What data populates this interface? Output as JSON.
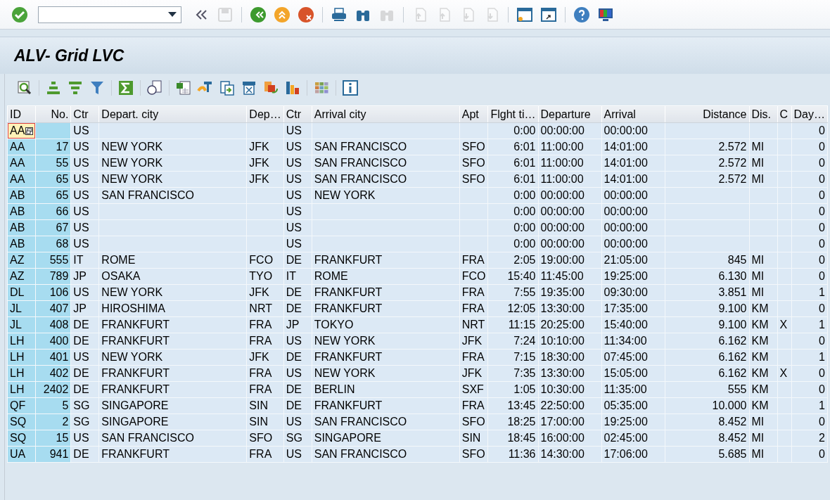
{
  "toolbar": [
    {
      "kind": "ok",
      "disabled": false
    },
    {
      "kind": "command-field",
      "disabled": false
    },
    {
      "kind": "collapse",
      "disabled": false
    },
    {
      "kind": "save",
      "disabled": true
    },
    {
      "kind": "sep"
    },
    {
      "kind": "back",
      "disabled": false
    },
    {
      "kind": "exit",
      "disabled": false
    },
    {
      "kind": "cancel",
      "disabled": false
    },
    {
      "kind": "sep"
    },
    {
      "kind": "print",
      "disabled": false
    },
    {
      "kind": "find",
      "disabled": false
    },
    {
      "kind": "find",
      "disabled": true
    },
    {
      "kind": "sep"
    },
    {
      "kind": "page-first",
      "disabled": true
    },
    {
      "kind": "page-prev",
      "disabled": true
    },
    {
      "kind": "page-next",
      "disabled": true
    },
    {
      "kind": "page-last",
      "disabled": true
    },
    {
      "kind": "sep"
    },
    {
      "kind": "new-session",
      "disabled": false
    },
    {
      "kind": "shortcut",
      "disabled": false
    },
    {
      "kind": "sep"
    },
    {
      "kind": "help",
      "disabled": false
    },
    {
      "kind": "layout",
      "disabled": false
    }
  ],
  "title": "ALV- Grid LVC",
  "grid_toolbar": [
    {
      "kind": "details"
    },
    {
      "kind": "sep"
    },
    {
      "kind": "sort-asc"
    },
    {
      "kind": "sort-desc"
    },
    {
      "kind": "filter"
    },
    {
      "kind": "sep"
    },
    {
      "kind": "sum"
    },
    {
      "kind": "sep"
    },
    {
      "kind": "print-preview"
    },
    {
      "kind": "sep"
    },
    {
      "kind": "excel"
    },
    {
      "kind": "word"
    },
    {
      "kind": "export"
    },
    {
      "kind": "abc"
    },
    {
      "kind": "office"
    },
    {
      "kind": "chart"
    },
    {
      "kind": "sep"
    },
    {
      "kind": "grid"
    },
    {
      "kind": "sep"
    },
    {
      "kind": "info"
    }
  ],
  "table": {
    "columns": [
      {
        "label": "ID",
        "kind": "text",
        "key": true
      },
      {
        "label": "No.",
        "kind": "number",
        "key": true
      },
      {
        "label": "Ctr",
        "kind": "text",
        "key": false
      },
      {
        "label": "Depart. city",
        "kind": "text",
        "key": false
      },
      {
        "label": "Dep…",
        "kind": "text",
        "key": false
      },
      {
        "label": "Ctr",
        "kind": "text",
        "key": false
      },
      {
        "label": "Arrival city",
        "kind": "text",
        "key": false
      },
      {
        "label": "Apt",
        "kind": "text",
        "key": false
      },
      {
        "label": "Flght ti…",
        "kind": "number",
        "key": false
      },
      {
        "label": "Departure",
        "kind": "text",
        "key": false
      },
      {
        "label": "Arrival",
        "kind": "text",
        "key": false
      },
      {
        "label": "Distance",
        "kind": "number",
        "key": false
      },
      {
        "label": "Dis.",
        "kind": "text",
        "key": false
      },
      {
        "label": "C",
        "kind": "text",
        "key": false
      },
      {
        "label": "Day…",
        "kind": "number",
        "key": false
      }
    ],
    "rows": [
      {
        "focused": true,
        "cells": [
          "AA",
          "",
          "US",
          "",
          "",
          "US",
          "",
          "",
          "0:00",
          "00:00:00",
          "00:00:00",
          "",
          "",
          "",
          "0"
        ]
      },
      {
        "focused": false,
        "cells": [
          "AA",
          "17",
          "US",
          "NEW YORK",
          "JFK",
          "US",
          "SAN FRANCISCO",
          "SFO",
          "6:01",
          "11:00:00",
          "14:01:00",
          "2.572",
          "MI",
          "",
          "0"
        ]
      },
      {
        "focused": false,
        "cells": [
          "AA",
          "55",
          "US",
          "NEW YORK",
          "JFK",
          "US",
          "SAN FRANCISCO",
          "SFO",
          "6:01",
          "11:00:00",
          "14:01:00",
          "2.572",
          "MI",
          "",
          "0"
        ]
      },
      {
        "focused": false,
        "cells": [
          "AA",
          "65",
          "US",
          "NEW YORK",
          "JFK",
          "US",
          "SAN FRANCISCO",
          "SFO",
          "6:01",
          "11:00:00",
          "14:01:00",
          "2.572",
          "MI",
          "",
          "0"
        ]
      },
      {
        "focused": false,
        "cells": [
          "AB",
          "65",
          "US",
          "SAN FRANCISCO",
          "",
          "US",
          "NEW YORK",
          "",
          "0:00",
          "00:00:00",
          "00:00:00",
          "",
          "",
          "",
          "0"
        ]
      },
      {
        "focused": false,
        "cells": [
          "AB",
          "66",
          "US",
          "",
          "",
          "US",
          "",
          "",
          "0:00",
          "00:00:00",
          "00:00:00",
          "",
          "",
          "",
          "0"
        ]
      },
      {
        "focused": false,
        "cells": [
          "AB",
          "67",
          "US",
          "",
          "",
          "US",
          "",
          "",
          "0:00",
          "00:00:00",
          "00:00:00",
          "",
          "",
          "",
          "0"
        ]
      },
      {
        "focused": false,
        "cells": [
          "AB",
          "68",
          "US",
          "",
          "",
          "US",
          "",
          "",
          "0:00",
          "00:00:00",
          "00:00:00",
          "",
          "",
          "",
          "0"
        ]
      },
      {
        "focused": false,
        "cells": [
          "AZ",
          "555",
          "IT",
          "ROME",
          "FCO",
          "DE",
          "FRANKFURT",
          "FRA",
          "2:05",
          "19:00:00",
          "21:05:00",
          "845",
          "MI",
          "",
          "0"
        ]
      },
      {
        "focused": false,
        "cells": [
          "AZ",
          "789",
          "JP",
          "OSAKA",
          "TYO",
          "IT",
          "ROME",
          "FCO",
          "15:40",
          "11:45:00",
          "19:25:00",
          "6.130",
          "MI",
          "",
          "0"
        ]
      },
      {
        "focused": false,
        "cells": [
          "DL",
          "106",
          "US",
          "NEW YORK",
          "JFK",
          "DE",
          "FRANKFURT",
          "FRA",
          "7:55",
          "19:35:00",
          "09:30:00",
          "3.851",
          "MI",
          "",
          "1"
        ]
      },
      {
        "focused": false,
        "cells": [
          "JL",
          "407",
          "JP",
          "HIROSHIMA",
          "NRT",
          "DE",
          "FRANKFURT",
          "FRA",
          "12:05",
          "13:30:00",
          "17:35:00",
          "9.100",
          "KM",
          "",
          "0"
        ]
      },
      {
        "focused": false,
        "cells": [
          "JL",
          "408",
          "DE",
          "FRANKFURT",
          "FRA",
          "JP",
          "TOKYO",
          "NRT",
          "11:15",
          "20:25:00",
          "15:40:00",
          "9.100",
          "KM",
          "X",
          "1"
        ]
      },
      {
        "focused": false,
        "cells": [
          "LH",
          "400",
          "DE",
          "FRANKFURT",
          "FRA",
          "US",
          "NEW YORK",
          "JFK",
          "7:24",
          "10:10:00",
          "11:34:00",
          "6.162",
          "KM",
          "",
          "0"
        ]
      },
      {
        "focused": false,
        "cells": [
          "LH",
          "401",
          "US",
          "NEW YORK",
          "JFK",
          "DE",
          "FRANKFURT",
          "FRA",
          "7:15",
          "18:30:00",
          "07:45:00",
          "6.162",
          "KM",
          "",
          "1"
        ]
      },
      {
        "focused": false,
        "cells": [
          "LH",
          "402",
          "DE",
          "FRANKFURT",
          "FRA",
          "US",
          "NEW YORK",
          "JFK",
          "7:35",
          "13:30:00",
          "15:05:00",
          "6.162",
          "KM",
          "X",
          "0"
        ]
      },
      {
        "focused": false,
        "cells": [
          "LH",
          "2402",
          "DE",
          "FRANKFURT",
          "FRA",
          "DE",
          "BERLIN",
          "SXF",
          "1:05",
          "10:30:00",
          "11:35:00",
          "555",
          "KM",
          "",
          "0"
        ]
      },
      {
        "focused": false,
        "cells": [
          "QF",
          "5",
          "SG",
          "SINGAPORE",
          "SIN",
          "DE",
          "FRANKFURT",
          "FRA",
          "13:45",
          "22:50:00",
          "05:35:00",
          "10.000",
          "KM",
          "",
          "1"
        ]
      },
      {
        "focused": false,
        "cells": [
          "SQ",
          "2",
          "SG",
          "SINGAPORE",
          "SIN",
          "US",
          "SAN FRANCISCO",
          "SFO",
          "18:25",
          "17:00:00",
          "19:25:00",
          "8.452",
          "MI",
          "",
          "0"
        ]
      },
      {
        "focused": false,
        "cells": [
          "SQ",
          "15",
          "US",
          "SAN FRANCISCO",
          "SFO",
          "SG",
          "SINGAPORE",
          "SIN",
          "18:45",
          "16:00:00",
          "02:45:00",
          "8.452",
          "MI",
          "",
          "2"
        ]
      },
      {
        "focused": false,
        "cells": [
          "UA",
          "941",
          "DE",
          "FRANKFURT",
          "FRA",
          "US",
          "SAN FRANCISCO",
          "SFO",
          "11:36",
          "14:30:00",
          "17:06:00",
          "5.685",
          "MI",
          "",
          "0"
        ]
      }
    ]
  }
}
